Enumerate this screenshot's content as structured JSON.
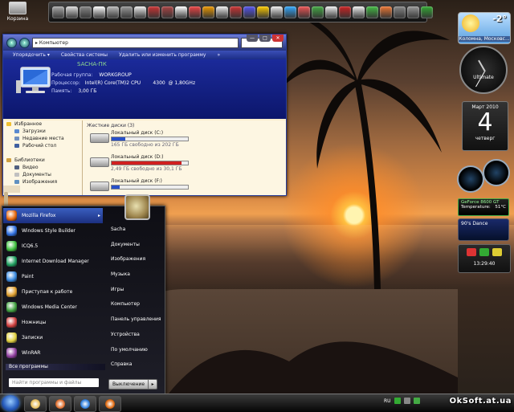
{
  "desktop": {
    "recycle_bin": "Корзина"
  },
  "explorer": {
    "address": "Компьютер",
    "commands": [
      "Упорядочить ▾",
      "Свойства системы",
      "Удалить или изменить программу",
      "»"
    ],
    "computer_name": "SACHA-ПК",
    "workgroup_label": "Рабочая группа:",
    "workgroup_value": "WORKGROUP",
    "cpu_label": "Процессор:",
    "cpu_value": "Intel(R) Core(TM)2 CPU        4300  @ 1,80GHz",
    "ram_label": "Память:",
    "ram_value": "3,00 ГБ",
    "nav": [
      {
        "label": "Избранное",
        "indent": false,
        "color": "#f0c030"
      },
      {
        "label": "Загрузки",
        "indent": true,
        "color": "#5a8ad0"
      },
      {
        "label": "Недавние места",
        "indent": true,
        "color": "#7090c0"
      },
      {
        "label": "Рабочий стол",
        "indent": true,
        "color": "#4060a0"
      },
      {
        "label": "",
        "indent": false,
        "color": "transparent"
      },
      {
        "label": "Библиотеки",
        "indent": false,
        "color": "#d0a040"
      },
      {
        "label": "Видео",
        "indent": true,
        "color": "#506080"
      },
      {
        "label": "Документы",
        "indent": true,
        "color": "#c0c0c0"
      },
      {
        "label": "Изображения",
        "indent": true,
        "color": "#6090c0"
      }
    ],
    "group_header": "Жесткие диски (3)",
    "drives": [
      {
        "name": "Локальный диск (C:)",
        "free": "165 ГБ свободно из 202 ГБ",
        "used_fraction": 0.18,
        "bar_color": "#2850c8"
      },
      {
        "name": "Локальный диск (D:)",
        "free": "2,49 ГБ свободно из 30,1 ГБ",
        "used_fraction": 0.92,
        "bar_color": "#d02020"
      },
      {
        "name": "Локальный диск (F:)",
        "free": "",
        "used_fraction": 0.1,
        "bar_color": "#2850c8"
      }
    ]
  },
  "start_menu": {
    "programs": [
      {
        "label": "Mozilla Firefox",
        "color": "#e86a10",
        "arrow": "▸",
        "selected": true
      },
      {
        "label": "Windows Style Builder",
        "color": "#3070e0",
        "arrow": "",
        "selected": false
      },
      {
        "label": "ICQ6.5",
        "color": "#40c040",
        "arrow": "",
        "selected": false
      },
      {
        "label": "Internet Download Manager",
        "color": "#20a060",
        "arrow": "",
        "selected": false
      },
      {
        "label": "Paint",
        "color": "#3a8ae0",
        "arrow": "",
        "selected": false
      },
      {
        "label": "Приступая к работе",
        "color": "#e0a030",
        "arrow": "",
        "selected": false
      },
      {
        "label": "Windows Media Center",
        "color": "#40a040",
        "arrow": "",
        "selected": false
      },
      {
        "label": "Ножницы",
        "color": "#d04040",
        "arrow": "",
        "selected": false
      },
      {
        "label": "Записки",
        "color": "#e0d040",
        "arrow": "",
        "selected": false
      },
      {
        "label": "WinRAR",
        "color": "#9040a0",
        "arrow": "",
        "selected": false
      }
    ],
    "all_programs": "Все программы",
    "search_placeholder": "Найти программы и файлы",
    "places": [
      "Sacha",
      "Документы",
      "Изображения",
      "Музыка",
      "Игры",
      "Компьютер",
      "Панель управления",
      "Устройства",
      "По умолчанию",
      "Справка"
    ],
    "shutdown_label": "Выключение",
    "shutdown_arrow": "▸"
  },
  "taskbar": {
    "items": [
      {
        "name": "explorer",
        "color": "#e8c060"
      },
      {
        "name": "media-player",
        "color": "#e07030"
      },
      {
        "name": "internet-explorer",
        "color": "#3080e0"
      },
      {
        "name": "firefox",
        "color": "#e06a10"
      }
    ],
    "language": "RU",
    "watermark": "OkSoft.at.ua"
  },
  "gadgets": {
    "weather_temp": "-2°",
    "weather_city": "Коломна, Московс...",
    "clock_label": "Ultimate",
    "calendar_month": "Март 2010",
    "calendar_day": "4",
    "calendar_weekday": "четверг",
    "gpu_title": "GeForce 8600 GT",
    "gpu_temp_label": "Temperature:",
    "gpu_temp_value": "51°C",
    "radio_station": "90's Dance",
    "time": "13:29:40"
  },
  "dock_icons": [
    "#aaa",
    "#ddd",
    "#888",
    "#fff",
    "#bbb",
    "#999",
    "#eee",
    "#c33",
    "#a44",
    "#fff",
    "#e44",
    "#e90",
    "#eee",
    "#c33",
    "#55e",
    "#fc0",
    "#eee",
    "#3af",
    "#e55",
    "#4a4",
    "#eee",
    "#c22",
    "#eee",
    "#4b4",
    "#e73",
    "#888",
    "#999",
    "#3a3"
  ]
}
